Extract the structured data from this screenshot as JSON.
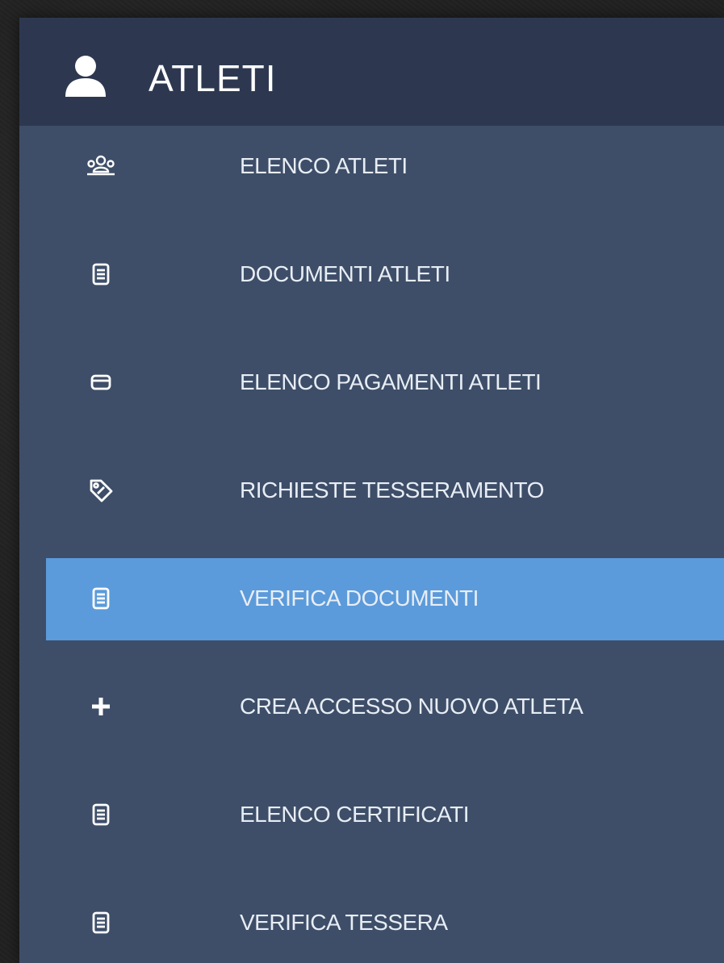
{
  "panel": {
    "title": "ATLETI",
    "icon": "user-icon"
  },
  "menu": {
    "items": [
      {
        "label": "ELENCO ATLETI",
        "icon": "users-group-icon",
        "active": false
      },
      {
        "label": "DOCUMENTI ATLETI",
        "icon": "document-icon",
        "active": false
      },
      {
        "label": "ELENCO PAGAMENTI ATLETI",
        "icon": "credit-card-icon",
        "active": false
      },
      {
        "label": "RICHIESTE TESSERAMENTO",
        "icon": "tag-icon",
        "active": false
      },
      {
        "label": "VERIFICA DOCUMENTI",
        "icon": "document-icon",
        "active": true
      },
      {
        "label": "CREA ACCESSO NUOVO ATLETA",
        "icon": "plus-icon",
        "active": false
      },
      {
        "label": "ELENCO CERTIFICATI",
        "icon": "document-icon",
        "active": false
      },
      {
        "label": "VERIFICA TESSERA",
        "icon": "document-icon",
        "active": false
      }
    ]
  },
  "colors": {
    "header_bg": "#2d3850",
    "panel_bg": "#3e4e68",
    "active_bg": "#5b9bdb",
    "text": "#e8edf5"
  }
}
